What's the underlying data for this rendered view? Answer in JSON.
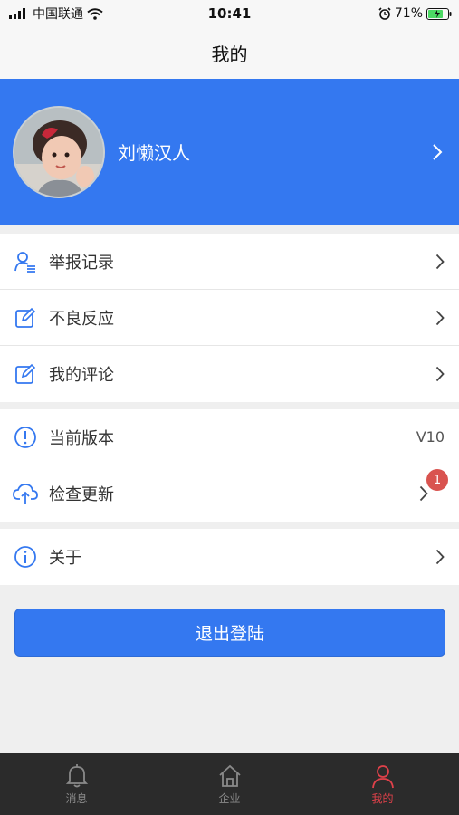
{
  "status_bar": {
    "carrier": "中国联通",
    "time": "10:41",
    "battery": "71%"
  },
  "nav": {
    "title": "我的"
  },
  "profile": {
    "name": "刘懒汉人"
  },
  "menu_group_1": [
    {
      "label": "举报记录",
      "icon": "user-list-icon"
    },
    {
      "label": "不良反应",
      "icon": "edit-icon"
    },
    {
      "label": "我的评论",
      "icon": "edit-icon"
    }
  ],
  "menu_group_2": [
    {
      "label": "当前版本",
      "icon": "info-circle-icon",
      "value": "V10"
    },
    {
      "label": "检查更新",
      "icon": "cloud-upload-icon",
      "badge": "1"
    }
  ],
  "menu_group_3": [
    {
      "label": "关于",
      "icon": "info-circle-icon"
    }
  ],
  "logout_label": "退出登陆",
  "tabbar": [
    {
      "label": "消息",
      "icon": "bell-icon",
      "active": false
    },
    {
      "label": "企业",
      "icon": "home-icon",
      "active": false
    },
    {
      "label": "我的",
      "icon": "person-icon",
      "active": true
    }
  ],
  "colors": {
    "primary": "#3478f0",
    "active_tab": "#e0414a",
    "badge": "#d9534f"
  }
}
